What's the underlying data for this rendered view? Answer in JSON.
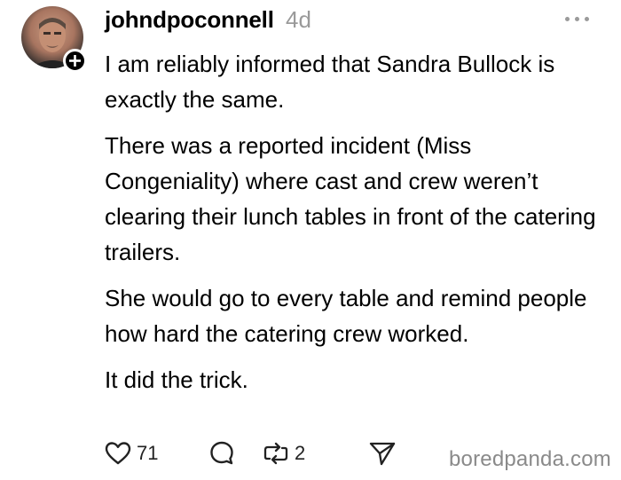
{
  "post": {
    "username": "johndpoconnell",
    "timestamp": "4d",
    "paragraphs": [
      "I am reliably informed that Sandra Bullock is exactly the same.",
      "There was a reported incident (Miss Congeniality) where cast and crew weren’t clearing their lunch tables in front of the catering trailers.",
      "She would go to every table and remind people how hard the catering crew worked.",
      "It did the trick."
    ]
  },
  "actions": {
    "likes": "71",
    "reposts": "2"
  },
  "watermark": "boredpanda.com",
  "icons": {
    "like": "heart-icon",
    "comment": "comment-icon",
    "repost": "repost-icon",
    "share": "send-icon",
    "more": "more-options-icon",
    "follow": "plus-icon"
  }
}
